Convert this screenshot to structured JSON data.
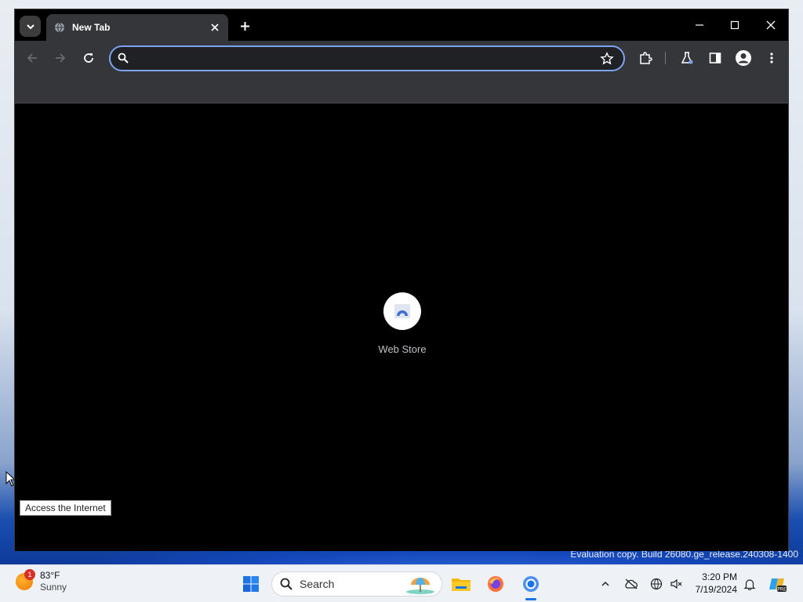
{
  "browser": {
    "tab": {
      "title": "New Tab"
    },
    "omnibox": {
      "value": "",
      "placeholder": ""
    },
    "shortcuts": [
      {
        "label": "Web Store"
      }
    ]
  },
  "desktop": {
    "tooltip": "Access the Internet",
    "watermark": "Evaluation copy. Build 26080.ge_release.240308-1400"
  },
  "taskbar": {
    "weather": {
      "temperature": "83°F",
      "condition": "Sunny",
      "badge": "1"
    },
    "search_label": "Search",
    "time": "3:20 PM",
    "date": "7/19/2024"
  },
  "colors": {
    "accent": "#7ca4f2",
    "toolbar": "#35363a",
    "taskbar_active": "#1a73e8"
  }
}
